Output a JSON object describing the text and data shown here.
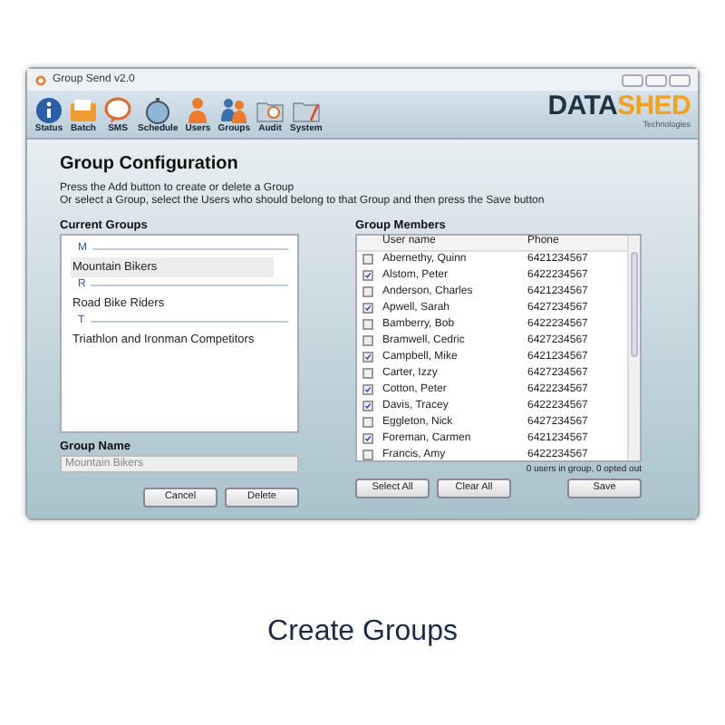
{
  "window": {
    "title": "Group Send v2.0"
  },
  "toolbar": [
    {
      "label": "Status"
    },
    {
      "label": "Batch"
    },
    {
      "label": "SMS"
    },
    {
      "label": "Schedule"
    },
    {
      "label": "Users"
    },
    {
      "label": "Groups"
    },
    {
      "label": "Audit"
    },
    {
      "label": "System"
    }
  ],
  "logo": {
    "text_dark": "DATA",
    "text_accent": "SHED",
    "tagline": "Technologies"
  },
  "heading": "Group Configuration",
  "instructions": [
    "Press the Add button to create or delete a Group",
    "Or select a Group, select the Users who should belong to that Group and then press the Save button"
  ],
  "current_groups": {
    "label": "Current Groups",
    "sections": [
      {
        "letter": "M",
        "groups": [
          {
            "name": "Mountain Bikers",
            "selected": true
          }
        ]
      },
      {
        "letter": "R",
        "groups": [
          {
            "name": "Road Bike Riders",
            "selected": false
          }
        ]
      },
      {
        "letter": "T",
        "groups": [
          {
            "name": "Triathlon and Ironman Competitors",
            "selected": false
          }
        ]
      }
    ]
  },
  "group_name": {
    "label": "Group Name",
    "value": "Mountain Bikers"
  },
  "left_buttons": [
    "Cancel",
    "Delete"
  ],
  "group_members": {
    "label": "Group Members",
    "columns": [
      "User name",
      "Phone"
    ],
    "rows": [
      {
        "name": "Abernethy, Quinn",
        "phone": "6421234567",
        "checked": false
      },
      {
        "name": "Alstom, Peter",
        "phone": "6422234567",
        "checked": true
      },
      {
        "name": "Anderson, Charles",
        "phone": "6421234567",
        "checked": false
      },
      {
        "name": "Apwell, Sarah",
        "phone": "6427234567",
        "checked": true
      },
      {
        "name": "Bamberry, Bob",
        "phone": "6422234567",
        "checked": false
      },
      {
        "name": "Bramwell, Cedric",
        "phone": "6427234567",
        "checked": false
      },
      {
        "name": "Campbell, Mike",
        "phone": "6421234567",
        "checked": true
      },
      {
        "name": "Carter, Izzy",
        "phone": "6427234567",
        "checked": false
      },
      {
        "name": "Cotton, Peter",
        "phone": "6422234567",
        "checked": true
      },
      {
        "name": "Davis, Tracey",
        "phone": "6422234567",
        "checked": true
      },
      {
        "name": "Eggleton, Nick",
        "phone": "6427234567",
        "checked": false
      },
      {
        "name": "Foreman, Carmen",
        "phone": "6421234567",
        "checked": true
      },
      {
        "name": "Francis, Amy",
        "phone": "6422234567",
        "checked": false
      }
    ],
    "summary": "0 users in group, 0 opted out"
  },
  "right_buttons": [
    "Select All",
    "Clear All"
  ],
  "save_button": "Save",
  "caption": "Create Groups"
}
